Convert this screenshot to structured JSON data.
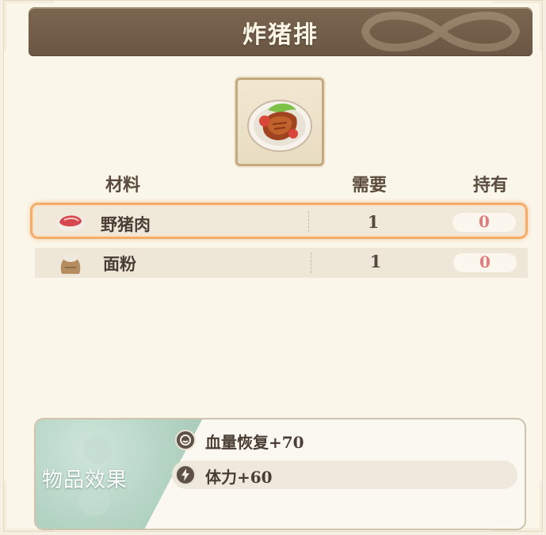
{
  "recipe": {
    "title": "炸猪排"
  },
  "materials": {
    "headers": {
      "name": "材料",
      "need": "需要",
      "owned": "持有"
    },
    "rows": [
      {
        "name": "野猪肉",
        "need": "1",
        "owned": "0",
        "icon": "boar-meat-icon"
      },
      {
        "name": "面粉",
        "need": "1",
        "owned": "0",
        "icon": "flour-sack-icon"
      }
    ]
  },
  "effects": {
    "title": "物品效果",
    "items": [
      {
        "text": "血量恢复+70",
        "icon": "hp-restore-icon"
      },
      {
        "text": "体力+60",
        "icon": "stamina-icon"
      }
    ]
  },
  "colors": {
    "title_bar": "#6f5a46",
    "selected_outline": "#f3ad6b",
    "owned_value": "#e07c7c",
    "effect_accent": "#b2d2c2"
  }
}
